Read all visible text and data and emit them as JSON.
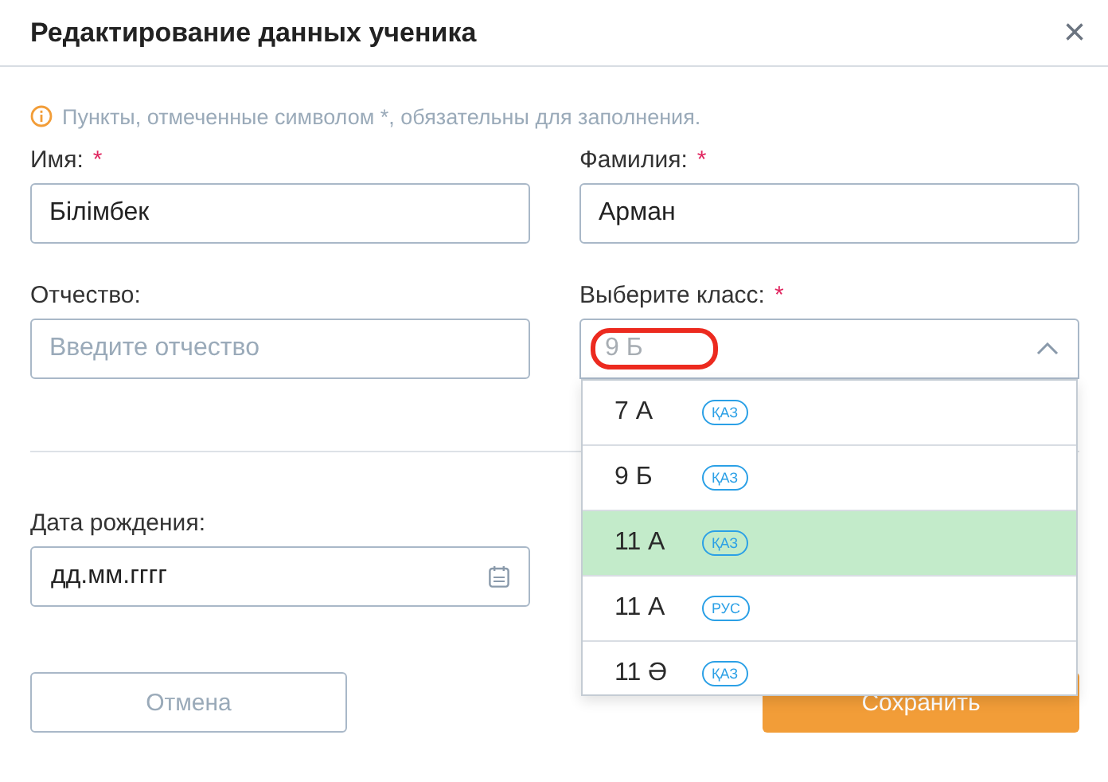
{
  "dialog": {
    "title": "Редактирование данных ученика",
    "close": "×"
  },
  "notice": "Пункты, отмеченные символом *, обязательны для заполнения.",
  "fields": [
    {
      "label": "Имя:",
      "required_mark": "*",
      "kind": "text",
      "value": "Білімбек"
    },
    {
      "label": "Фамилия:",
      "required_mark": "*",
      "kind": "text",
      "value": "Арман"
    },
    {
      "label": "Отчество:",
      "kind": "text",
      "placeholder": "Введите отчество"
    },
    {
      "label": "Выберите класс:",
      "required_mark": "*",
      "kind": "select",
      "placeholder": "9 Б",
      "highlighted": true,
      "expanded": true
    }
  ],
  "date_field": {
    "label": "Дата рождения:",
    "placeholder": "дд.мм.гггг"
  },
  "class_options": [
    {
      "label": "7 А",
      "tag": "ҚАЗ",
      "selected": false
    },
    {
      "label": "9 Б",
      "tag": "ҚАЗ",
      "selected": false
    },
    {
      "label": "11 А",
      "tag": "ҚАЗ",
      "selected": true
    },
    {
      "label": "11 А",
      "tag": "РУС",
      "selected": false
    },
    {
      "label": "11 Ә",
      "tag": "ҚАЗ",
      "selected": false
    }
  ],
  "buttons": [
    {
      "label": "Отмена",
      "kind": "secondary"
    },
    {
      "label": "Сохранить",
      "kind": "primary"
    }
  ]
}
